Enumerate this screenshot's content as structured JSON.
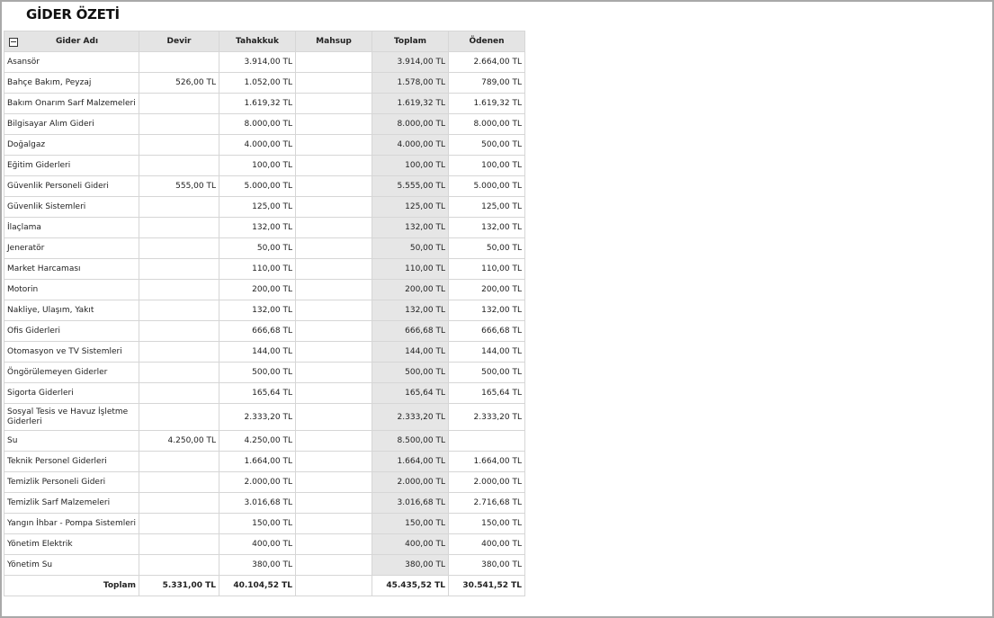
{
  "report": {
    "title": "GİDER ÖZETİ"
  },
  "columns": {
    "name": "Gider Adı",
    "devir": "Devir",
    "tahakkuk": "Tahakkuk",
    "mahsup": "Mahsup",
    "toplam": "Toplam",
    "odenen": "Ödenen"
  },
  "rows": [
    {
      "name": "Asansör",
      "devir": "",
      "tahakkuk": "3.914,00 TL",
      "mahsup": "",
      "toplam": "3.914,00 TL",
      "odenen": "2.664,00 TL"
    },
    {
      "name": "Bahçe Bakım, Peyzaj",
      "devir": "526,00 TL",
      "tahakkuk": "1.052,00 TL",
      "mahsup": "",
      "toplam": "1.578,00 TL",
      "odenen": "789,00 TL"
    },
    {
      "name": "Bakım Onarım Sarf Malzemeleri",
      "devir": "",
      "tahakkuk": "1.619,32 TL",
      "mahsup": "",
      "toplam": "1.619,32 TL",
      "odenen": "1.619,32 TL"
    },
    {
      "name": "Bilgisayar Alım Gideri",
      "devir": "",
      "tahakkuk": "8.000,00 TL",
      "mahsup": "",
      "toplam": "8.000,00 TL",
      "odenen": "8.000,00 TL"
    },
    {
      "name": "Doğalgaz",
      "devir": "",
      "tahakkuk": "4.000,00 TL",
      "mahsup": "",
      "toplam": "4.000,00 TL",
      "odenen": "500,00 TL"
    },
    {
      "name": "Eğitim Giderleri",
      "devir": "",
      "tahakkuk": "100,00 TL",
      "mahsup": "",
      "toplam": "100,00 TL",
      "odenen": "100,00 TL"
    },
    {
      "name": "Güvenlik Personeli Gideri",
      "devir": "555,00 TL",
      "tahakkuk": "5.000,00 TL",
      "mahsup": "",
      "toplam": "5.555,00 TL",
      "odenen": "5.000,00 TL"
    },
    {
      "name": "Güvenlik Sistemleri",
      "devir": "",
      "tahakkuk": "125,00 TL",
      "mahsup": "",
      "toplam": "125,00 TL",
      "odenen": "125,00 TL"
    },
    {
      "name": "İlaçlama",
      "devir": "",
      "tahakkuk": "132,00 TL",
      "mahsup": "",
      "toplam": "132,00 TL",
      "odenen": "132,00 TL"
    },
    {
      "name": "Jeneratör",
      "devir": "",
      "tahakkuk": "50,00 TL",
      "mahsup": "",
      "toplam": "50,00 TL",
      "odenen": "50,00 TL"
    },
    {
      "name": "Market Harcaması",
      "devir": "",
      "tahakkuk": "110,00 TL",
      "mahsup": "",
      "toplam": "110,00 TL",
      "odenen": "110,00 TL"
    },
    {
      "name": "Motorin",
      "devir": "",
      "tahakkuk": "200,00 TL",
      "mahsup": "",
      "toplam": "200,00 TL",
      "odenen": "200,00 TL"
    },
    {
      "name": "Nakliye, Ulaşım, Yakıt",
      "devir": "",
      "tahakkuk": "132,00 TL",
      "mahsup": "",
      "toplam": "132,00 TL",
      "odenen": "132,00 TL"
    },
    {
      "name": "Ofis Giderleri",
      "devir": "",
      "tahakkuk": "666,68 TL",
      "mahsup": "",
      "toplam": "666,68 TL",
      "odenen": "666,68 TL"
    },
    {
      "name": "Otomasyon ve TV Sistemleri",
      "devir": "",
      "tahakkuk": "144,00 TL",
      "mahsup": "",
      "toplam": "144,00 TL",
      "odenen": "144,00 TL"
    },
    {
      "name": "Öngörülemeyen Giderler",
      "devir": "",
      "tahakkuk": "500,00 TL",
      "mahsup": "",
      "toplam": "500,00 TL",
      "odenen": "500,00 TL"
    },
    {
      "name": "Sigorta Giderleri",
      "devir": "",
      "tahakkuk": "165,64 TL",
      "mahsup": "",
      "toplam": "165,64 TL",
      "odenen": "165,64 TL"
    },
    {
      "name": "Sosyal Tesis ve Havuz İşletme Giderleri",
      "devir": "",
      "tahakkuk": "2.333,20 TL",
      "mahsup": "",
      "toplam": "2.333,20 TL",
      "odenen": "2.333,20 TL"
    },
    {
      "name": "Su",
      "devir": "4.250,00 TL",
      "tahakkuk": "4.250,00 TL",
      "mahsup": "",
      "toplam": "8.500,00 TL",
      "odenen": ""
    },
    {
      "name": "Teknik Personel Giderleri",
      "devir": "",
      "tahakkuk": "1.664,00 TL",
      "mahsup": "",
      "toplam": "1.664,00 TL",
      "odenen": "1.664,00 TL"
    },
    {
      "name": "Temizlik Personeli Gideri",
      "devir": "",
      "tahakkuk": "2.000,00 TL",
      "mahsup": "",
      "toplam": "2.000,00 TL",
      "odenen": "2.000,00 TL"
    },
    {
      "name": "Temizlik Sarf Malzemeleri",
      "devir": "",
      "tahakkuk": "3.016,68 TL",
      "mahsup": "",
      "toplam": "3.016,68 TL",
      "odenen": "2.716,68 TL"
    },
    {
      "name": "Yangın İhbar - Pompa Sistemleri",
      "devir": "",
      "tahakkuk": "150,00 TL",
      "mahsup": "",
      "toplam": "150,00 TL",
      "odenen": "150,00 TL"
    },
    {
      "name": "Yönetim Elektrik",
      "devir": "",
      "tahakkuk": "400,00 TL",
      "mahsup": "",
      "toplam": "400,00 TL",
      "odenen": "400,00 TL"
    },
    {
      "name": "Yönetim Su",
      "devir": "",
      "tahakkuk": "380,00 TL",
      "mahsup": "",
      "toplam": "380,00 TL",
      "odenen": "380,00 TL"
    }
  ],
  "totals": {
    "label": "Toplam",
    "devir": "5.331,00 TL",
    "tahakkuk": "40.104,52 TL",
    "mahsup": "",
    "toplam": "45.435,52 TL",
    "odenen": "30.541,52 TL"
  },
  "colors": {
    "header_bg": "#e4e4e4",
    "total_col_bg": "#e6e6e6",
    "border": "#d6d6d6",
    "frame": "#a9a9a9"
  }
}
